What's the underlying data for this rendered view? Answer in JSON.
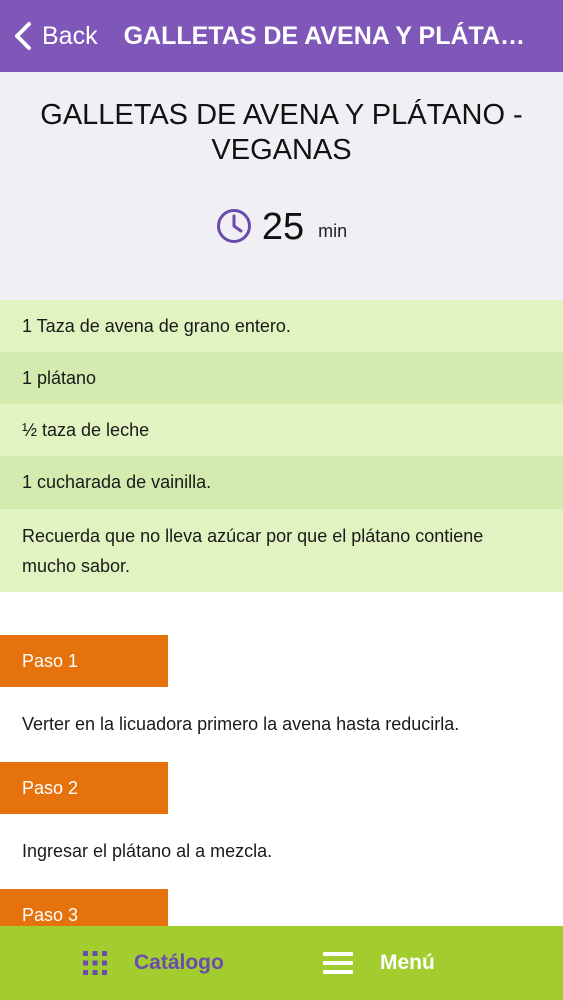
{
  "navbar": {
    "back_label": "Back",
    "title": "GALLETAS DE AVENA Y PLÁTANO - VEGANAS"
  },
  "recipe": {
    "title": "GALLETAS DE AVENA Y PLÁTANO - VEGANAS",
    "time_value": "25",
    "time_unit": "min",
    "clock_icon": "clock-icon"
  },
  "ingredients": [
    "1 Taza de avena de grano entero.",
    "1 plátano",
    "½ taza de leche",
    "1 cucharada de vainilla.",
    "Recuerda que no lleva azúcar por que el plátano contiene mucho sabor."
  ],
  "steps": [
    {
      "label": "Paso 1",
      "text": "Verter en la licuadora primero la avena hasta reducirla."
    },
    {
      "label": "Paso 2",
      "text": "Ingresar el plátano al a mezcla."
    },
    {
      "label": "Paso 3",
      "text": ""
    }
  ],
  "tabbar": {
    "catalog_label": "Catálogo",
    "catalog_icon": "grid-icon",
    "menu_label": "Menú",
    "menu_icon": "hamburger-icon"
  },
  "colors": {
    "navbar": "#7e57b9",
    "header_bg": "#efeff4",
    "ingredient_light": "#e0f3c0",
    "ingredient_dark": "#d4ebaf",
    "step_badge": "#e5720d",
    "tabbar": "#a3cd2e",
    "accent_purple": "#6a4cae"
  }
}
